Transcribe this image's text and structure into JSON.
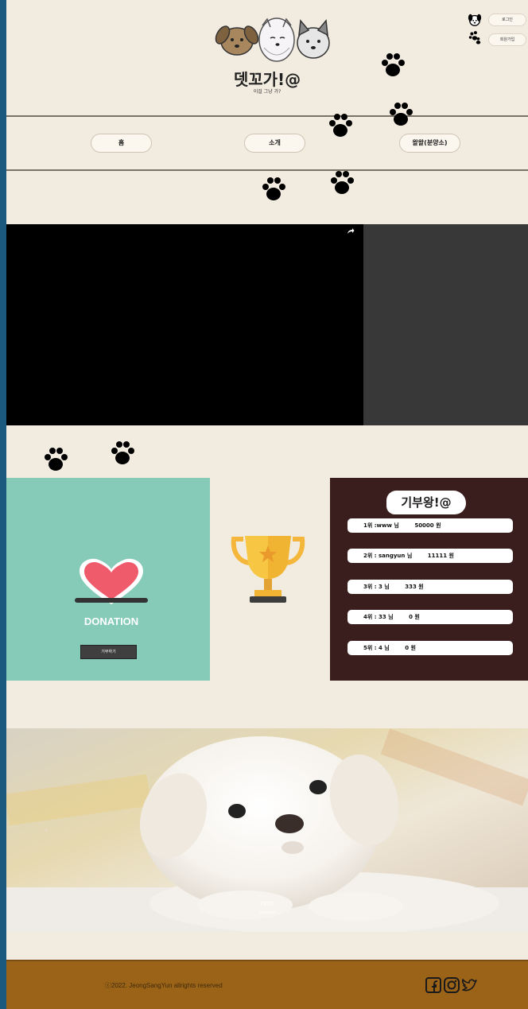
{
  "header": {
    "site_title": "뎃꼬가!@",
    "site_subtitle": "이걸 그냥 가?",
    "login_label": "로그인",
    "signup_label": "회원가입"
  },
  "nav": {
    "items": [
      {
        "label": "홈"
      },
      {
        "label": "소개"
      },
      {
        "label": "왈왈(분양소)"
      }
    ]
  },
  "donation": {
    "label": "DONATION",
    "button_label": "기부하기"
  },
  "ranking": {
    "title": "기부왕!@",
    "rows": [
      {
        "text": "1위 :www 님        50000 원"
      },
      {
        "text": "2위 : sangyun 님        11111 원"
      },
      {
        "text": "3위 : 3 님        333 원"
      },
      {
        "text": "4위 : 33 님        0 원"
      },
      {
        "text": "5위 : 4 님        0 원"
      }
    ]
  },
  "carousel": {
    "caption_title": "TEST",
    "caption_text": "content",
    "prev": "‹",
    "next": "›"
  },
  "footer": {
    "copyright": "ⓒ2022. JeongSangYun allrights reserved"
  },
  "colors": {
    "background": "#f2ebe0",
    "donation_panel": "#85cbb8",
    "ranking_panel": "#3a1d1d",
    "footer": "#9b6318",
    "left_bar": "#1b5a7e"
  }
}
